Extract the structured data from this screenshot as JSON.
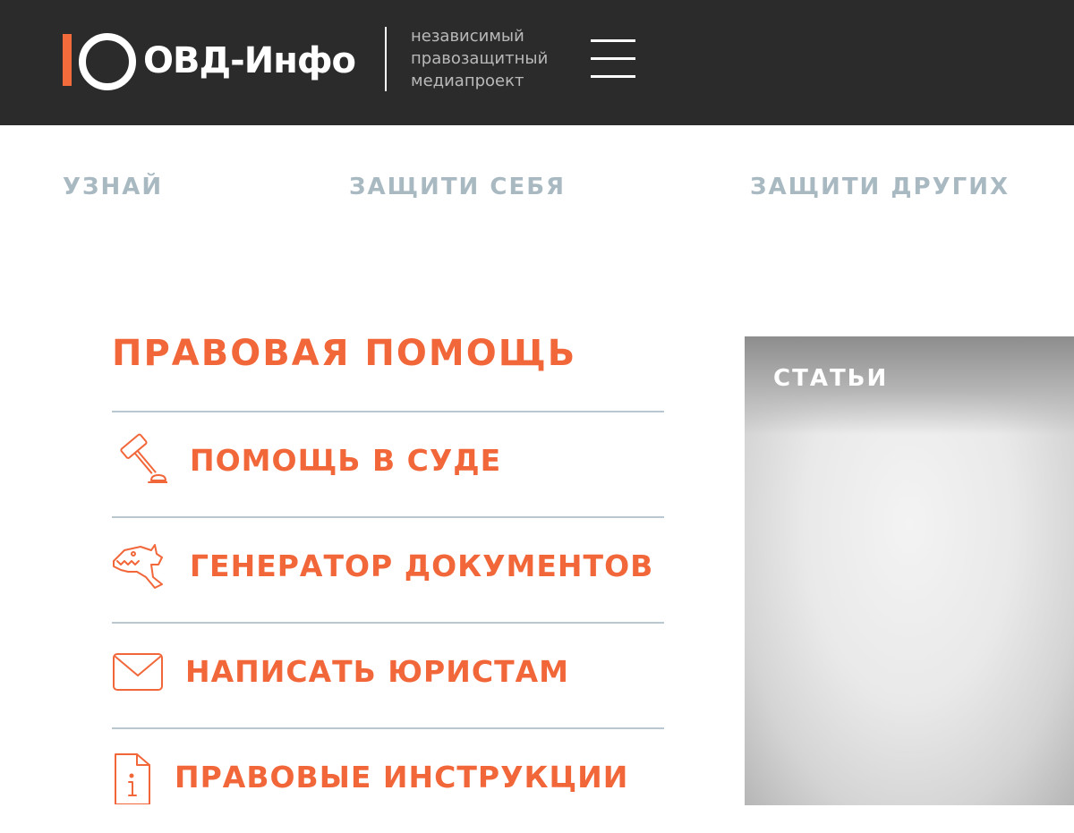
{
  "header": {
    "logo_text": "ОВД-Инфо",
    "tagline": [
      "независимый",
      "правозащитный",
      "медиапроект"
    ],
    "menu_icon": "hamburger-menu-icon"
  },
  "nav": {
    "items": [
      {
        "label": "УЗНАЙ"
      },
      {
        "label": "ЗАЩИТИ СЕБЯ"
      },
      {
        "label": "ЗАЩИТИ ДРУГИХ"
      }
    ]
  },
  "legal_help": {
    "title": "ПРАВОВАЯ ПОМОЩЬ",
    "items": [
      {
        "label": "ПОМОЩЬ В СУДЕ",
        "icon": "gavel-icon"
      },
      {
        "label": "ГЕНЕРАТОР ДОКУМЕНТОВ",
        "icon": "dinosaur-icon"
      },
      {
        "label": "НАПИСАТЬ ЮРИСТАМ",
        "icon": "envelope-icon"
      },
      {
        "label": "ПРАВОВЫЕ ИНСТРУКЦИИ",
        "icon": "info-document-icon"
      }
    ]
  },
  "articles": {
    "label": "СТАТЬИ"
  },
  "colors": {
    "header_bg": "#2b2b2b",
    "accent": "#f2673a",
    "nav_text": "#a9b9c2",
    "divider": "#b9c8d0"
  }
}
